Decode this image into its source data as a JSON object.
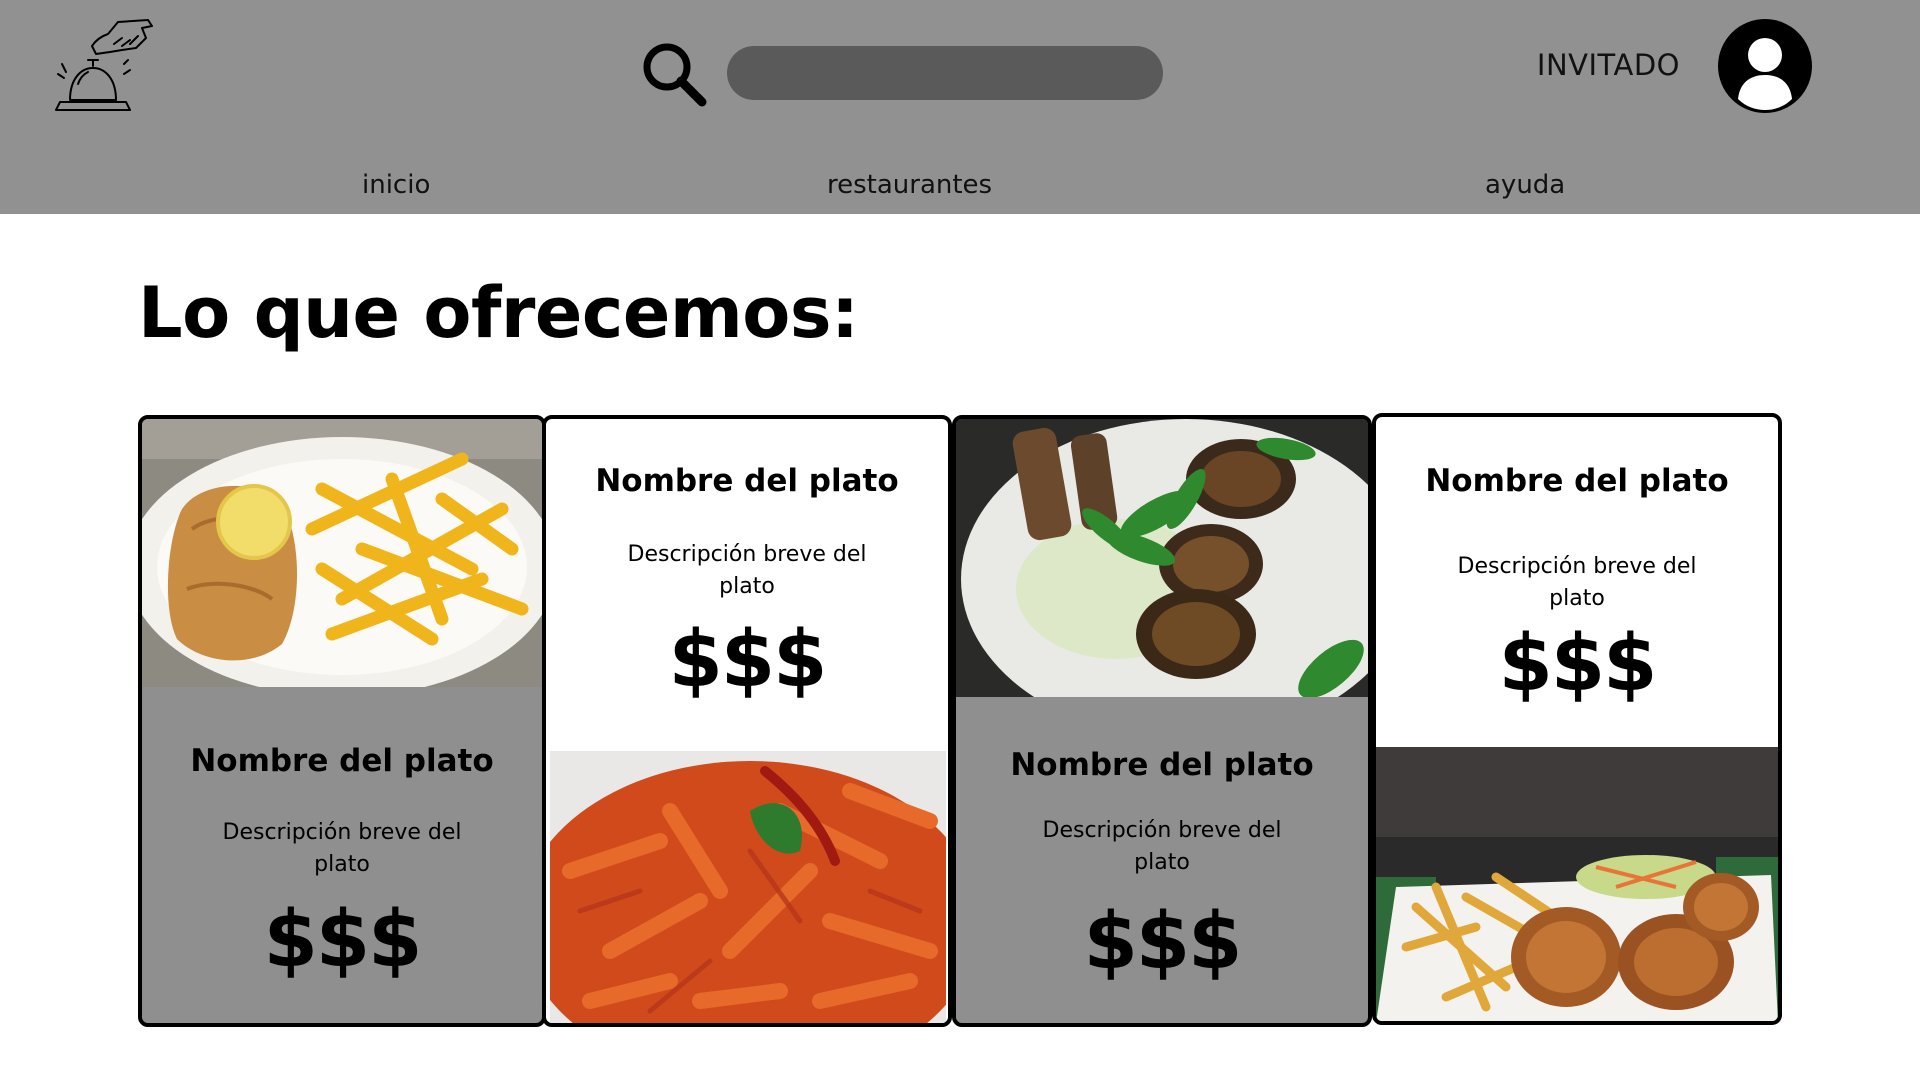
{
  "header": {
    "user_label": "INVITADO",
    "search": {
      "value": "",
      "placeholder": ""
    },
    "nav": [
      {
        "label": "inicio"
      },
      {
        "label": "restaurantes"
      },
      {
        "label": "ayuda"
      }
    ],
    "colors": {
      "header_bg": "#919191",
      "search_bg": "#5a5a5a"
    }
  },
  "main": {
    "title": "Lo que ofrecemos:",
    "cards": [
      {
        "name": "Nombre del plato",
        "description": "Descripción breve del plato",
        "price": "$$$",
        "image": "schnitzel-with-fries",
        "style": "gray"
      },
      {
        "name": "Nombre del plato",
        "description": "Descripción breve del plato",
        "price": "$$$",
        "image": "penne-pasta",
        "style": "white"
      },
      {
        "name": "Nombre del plato",
        "description": "Descripción breve del plato",
        "price": "$$$",
        "image": "vegetable-patties-salad",
        "style": "gray"
      },
      {
        "name": "Nombre del plato",
        "description": "Descripción breve del plato",
        "price": "$$$",
        "image": "fried-chicken-fries",
        "style": "white"
      }
    ]
  },
  "icons": {
    "logo": "service-bell-icon",
    "search": "search-icon",
    "avatar": "user-avatar-icon"
  }
}
